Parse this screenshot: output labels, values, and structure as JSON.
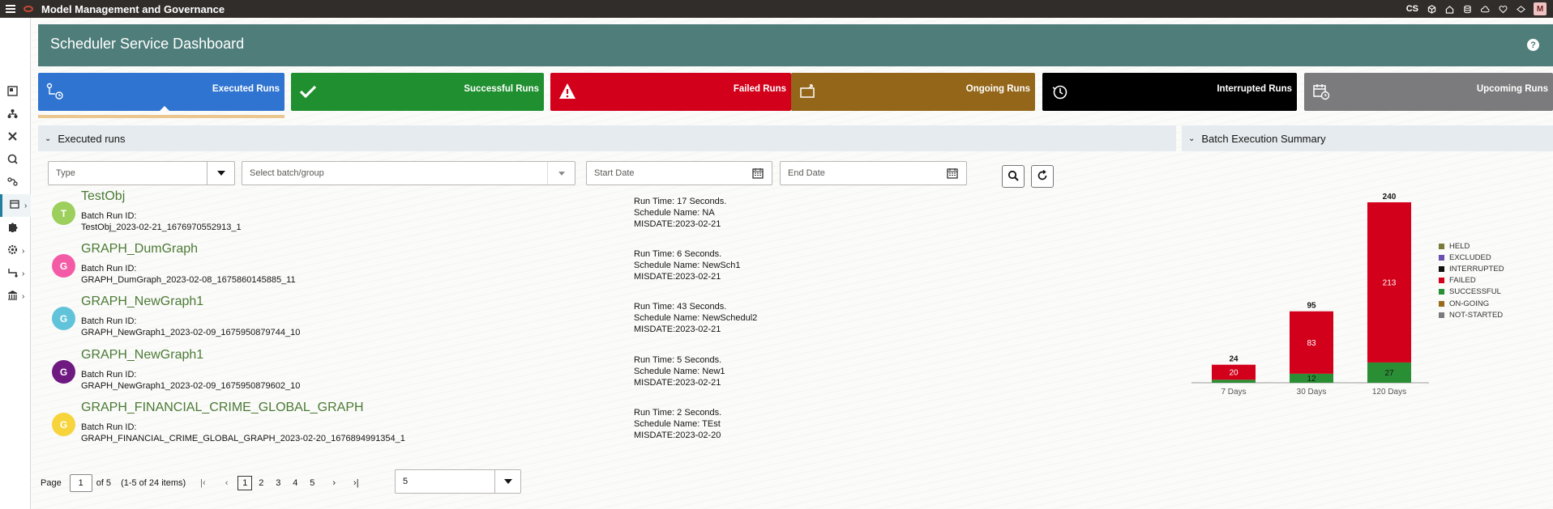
{
  "app": {
    "title": "Model Management and Governance",
    "user_initials": "CS",
    "avatar_letter": "M"
  },
  "dashboard": {
    "title": "Scheduler Service Dashboard",
    "help_symbol": "?"
  },
  "cards": [
    {
      "label": "Executed Runs",
      "color": "#2f74d0",
      "icon": "executed-runs-icon"
    },
    {
      "label": "Successful Runs",
      "color": "#1f8f2f",
      "icon": "check-icon"
    },
    {
      "label": "Failed Runs",
      "color": "#d2001a",
      "icon": "warning-icon"
    },
    {
      "label": "Ongoing Runs",
      "color": "#946619",
      "icon": "ongoing-icon"
    },
    {
      "label": "Interrupted Runs",
      "color": "#000000",
      "icon": "interrupted-icon"
    },
    {
      "label": "Upcoming Runs",
      "color": "#7b7b7d",
      "icon": "calendar-clock-icon"
    }
  ],
  "executed_section": {
    "title": "Executed runs"
  },
  "summary_section": {
    "title": "Batch Execution Summary"
  },
  "filters": {
    "type_placeholder": "Type",
    "batch_placeholder": "Select batch/group",
    "start_placeholder": "Start Date",
    "end_placeholder": "End Date"
  },
  "runs": [
    {
      "initial": "T",
      "avatar_color": "#9ccf5c",
      "name": "TestObj",
      "batch_label": "Batch Run ID:",
      "batch_id": "TestObj_2023-02-21_1676970552913_1",
      "run_time": "Run Time: 17 Seconds.",
      "schedule": "Schedule Name: NA",
      "misdate": "MISDATE:2023-02-21"
    },
    {
      "initial": "G",
      "avatar_color": "#f45ba6",
      "name": "GRAPH_DumGraph",
      "batch_label": "Batch Run ID:",
      "batch_id": "GRAPH_DumGraph_2023-02-08_1675860145885_11",
      "run_time": "Run Time: 6 Seconds.",
      "schedule": "Schedule Name: NewSch1",
      "misdate": "MISDATE:2023-02-21"
    },
    {
      "initial": "G",
      "avatar_color": "#61c3d9",
      "name": "GRAPH_NewGraph1",
      "batch_label": "Batch Run ID:",
      "batch_id": "GRAPH_NewGraph1_2023-02-09_1675950879744_10",
      "run_time": "Run Time: 43 Seconds.",
      "schedule": "Schedule Name: NewSchedul2",
      "misdate": "MISDATE:2023-02-21"
    },
    {
      "initial": "G",
      "avatar_color": "#6e1a80",
      "name": "GRAPH_NewGraph1",
      "batch_label": "Batch Run ID:",
      "batch_id": "GRAPH_NewGraph1_2023-02-09_1675950879602_10",
      "run_time": "Run Time: 5 Seconds.",
      "schedule": "Schedule Name: New1",
      "misdate": "MISDATE:2023-02-21"
    },
    {
      "initial": "G",
      "avatar_color": "#f7d43b",
      "name": "GRAPH_FINANCIAL_CRIME_GLOBAL_GRAPH",
      "batch_label": "Batch Run ID:",
      "batch_id": "GRAPH_FINANCIAL_CRIME_GLOBAL_GRAPH_2023-02-20_1676894991354_1",
      "run_time": "Run Time: 2 Seconds.",
      "schedule": "Schedule Name: TEst",
      "misdate": "MISDATE:2023-02-20"
    }
  ],
  "pagination": {
    "page_label": "Page",
    "current_page": "1",
    "of_label": "of 5",
    "range_label": "(1-5 of 24 items)",
    "pages": [
      "1",
      "2",
      "3",
      "4",
      "5"
    ],
    "page_size": "5"
  },
  "chart_data": {
    "type": "bar",
    "stacked": true,
    "categories": [
      "7 Days",
      "30 Days",
      "120 Days"
    ],
    "totals": [
      24,
      95,
      240
    ],
    "series": [
      {
        "name": "HELD",
        "color": "#7a7a3a",
        "values": [
          0,
          0,
          0
        ]
      },
      {
        "name": "EXCLUDED",
        "color": "#6a4fb0",
        "values": [
          0,
          0,
          0
        ]
      },
      {
        "name": "INTERRUPTED",
        "color": "#111111",
        "values": [
          0,
          0,
          0
        ]
      },
      {
        "name": "FAILED",
        "color": "#d2001a",
        "values": [
          20,
          83,
          213
        ]
      },
      {
        "name": "SUCCESSFUL",
        "color": "#2a8f34",
        "values": [
          4,
          12,
          27
        ]
      },
      {
        "name": "ON-GOING",
        "color": "#9a6a1c",
        "values": [
          0,
          0,
          0
        ]
      },
      {
        "name": "NOT-STARTED",
        "color": "#7b7b7d",
        "values": [
          0,
          0,
          0
        ]
      }
    ],
    "visible_segment_labels": {
      "FAILED": [
        true,
        true,
        true
      ],
      "SUCCESSFUL": [
        false,
        true,
        true
      ]
    },
    "ylim": [
      0,
      240
    ],
    "legend": "right"
  }
}
